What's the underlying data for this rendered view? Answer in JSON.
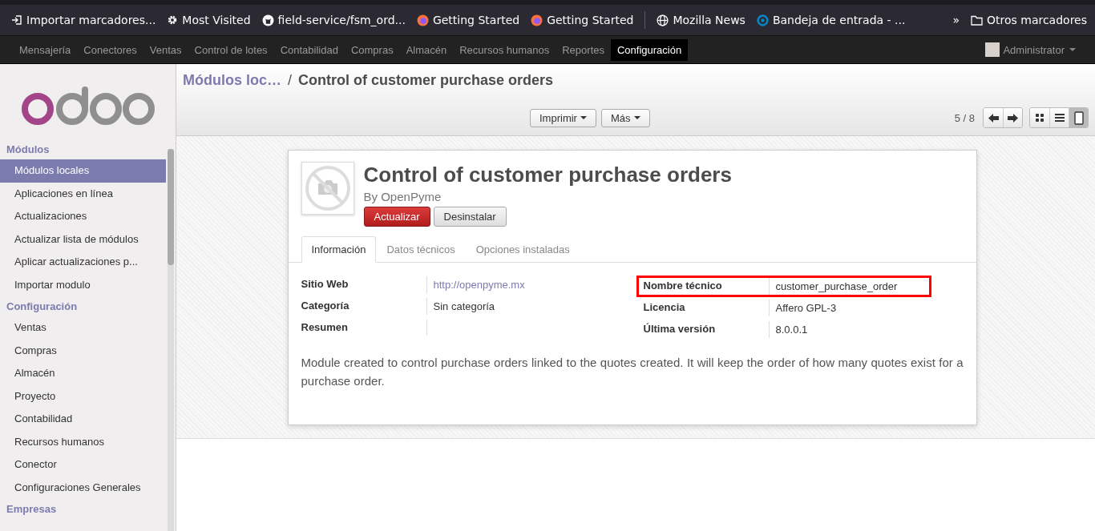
{
  "bookmarks": [
    {
      "label": "Importar marcadores...",
      "kind": "import"
    },
    {
      "label": "Most Visited",
      "kind": "gear"
    },
    {
      "label": "field-service/fsm_ord...",
      "kind": "repo"
    },
    {
      "label": "Getting Started",
      "kind": "browser"
    },
    {
      "label": "Getting Started",
      "kind": "browser"
    },
    {
      "label": "Mozilla News",
      "kind": "globe"
    },
    {
      "label": "Bandeja de entrada - ...",
      "kind": "ring"
    }
  ],
  "bookmarks_overflow": "»",
  "other_bookmarks": "Otros marcadores",
  "top_menu": [
    {
      "label": "Mensajería",
      "selected": false
    },
    {
      "label": "Conectores",
      "selected": false
    },
    {
      "label": "Ventas",
      "selected": false
    },
    {
      "label": "Control de lotes",
      "selected": false
    },
    {
      "label": "Contabilidad",
      "selected": false
    },
    {
      "label": "Compras",
      "selected": false
    },
    {
      "label": "Almacén",
      "selected": false
    },
    {
      "label": "Recursos humanos",
      "selected": false
    },
    {
      "label": "Reportes",
      "selected": false
    },
    {
      "label": "Configuración",
      "selected": true
    }
  ],
  "user": {
    "name": "Administrator"
  },
  "sidebar": {
    "sections": [
      {
        "title": "Módulos",
        "items": [
          {
            "label": "Módulos locales",
            "selected": true
          },
          {
            "label": "Aplicaciones en línea",
            "selected": false
          },
          {
            "label": "Actualizaciones",
            "selected": false
          },
          {
            "label": "Actualizar lista de módulos",
            "selected": false
          },
          {
            "label": "Aplicar actualizaciones p...",
            "selected": false
          },
          {
            "label": "Importar modulo",
            "selected": false
          }
        ]
      },
      {
        "title": "Configuración",
        "items": [
          {
            "label": "Ventas",
            "selected": false
          },
          {
            "label": "Compras",
            "selected": false
          },
          {
            "label": "Almacén",
            "selected": false
          },
          {
            "label": "Proyecto",
            "selected": false
          },
          {
            "label": "Contabilidad",
            "selected": false
          },
          {
            "label": "Recursos humanos",
            "selected": false
          },
          {
            "label": "Conector",
            "selected": false
          },
          {
            "label": "Configuraciones Generales",
            "selected": false
          }
        ]
      },
      {
        "title": "Empresas"
      }
    ]
  },
  "breadcrumb": {
    "parent": "Módulos loc…",
    "separator": "/",
    "current": "Control of customer purchase orders"
  },
  "toolbar": {
    "buttons": [
      "Imprimir",
      "Más"
    ],
    "pager": "5 / 8",
    "views": [
      {
        "kind": "kanban",
        "selected": false
      },
      {
        "kind": "list",
        "selected": false
      },
      {
        "kind": "form",
        "selected": true
      }
    ]
  },
  "module": {
    "title": "Control of customer purchase orders",
    "by": "By",
    "author": "OpenPyme",
    "actions": [
      {
        "label": "Actualizar",
        "kind": "primary"
      },
      {
        "label": "Desinstalar",
        "kind": "default"
      }
    ],
    "tabs": [
      {
        "label": "Información",
        "selected": true
      },
      {
        "label": "Datos técnicos",
        "selected": false
      },
      {
        "label": "Opciones instaladas",
        "selected": false
      }
    ],
    "website": {
      "label": "Sitio Web",
      "value": "http://openpyme.mx"
    },
    "left_fields": [
      {
        "label": "Categoría",
        "value": "Sin categoría"
      },
      {
        "label": "Resumen"
      }
    ],
    "right_fields": [
      {
        "label": "Nombre técnico",
        "value": "customer_purchase_order",
        "highlighted": true
      },
      {
        "label": "Licencia",
        "value": "Affero GPL-3",
        "highlighted": false
      },
      {
        "label": "Última versión",
        "value": "8.0.0.1",
        "highlighted": false
      }
    ],
    "description": "Module created to control purchase orders linked to the quotes created. It will keep the order of how many quotes exist for a purchase order."
  }
}
